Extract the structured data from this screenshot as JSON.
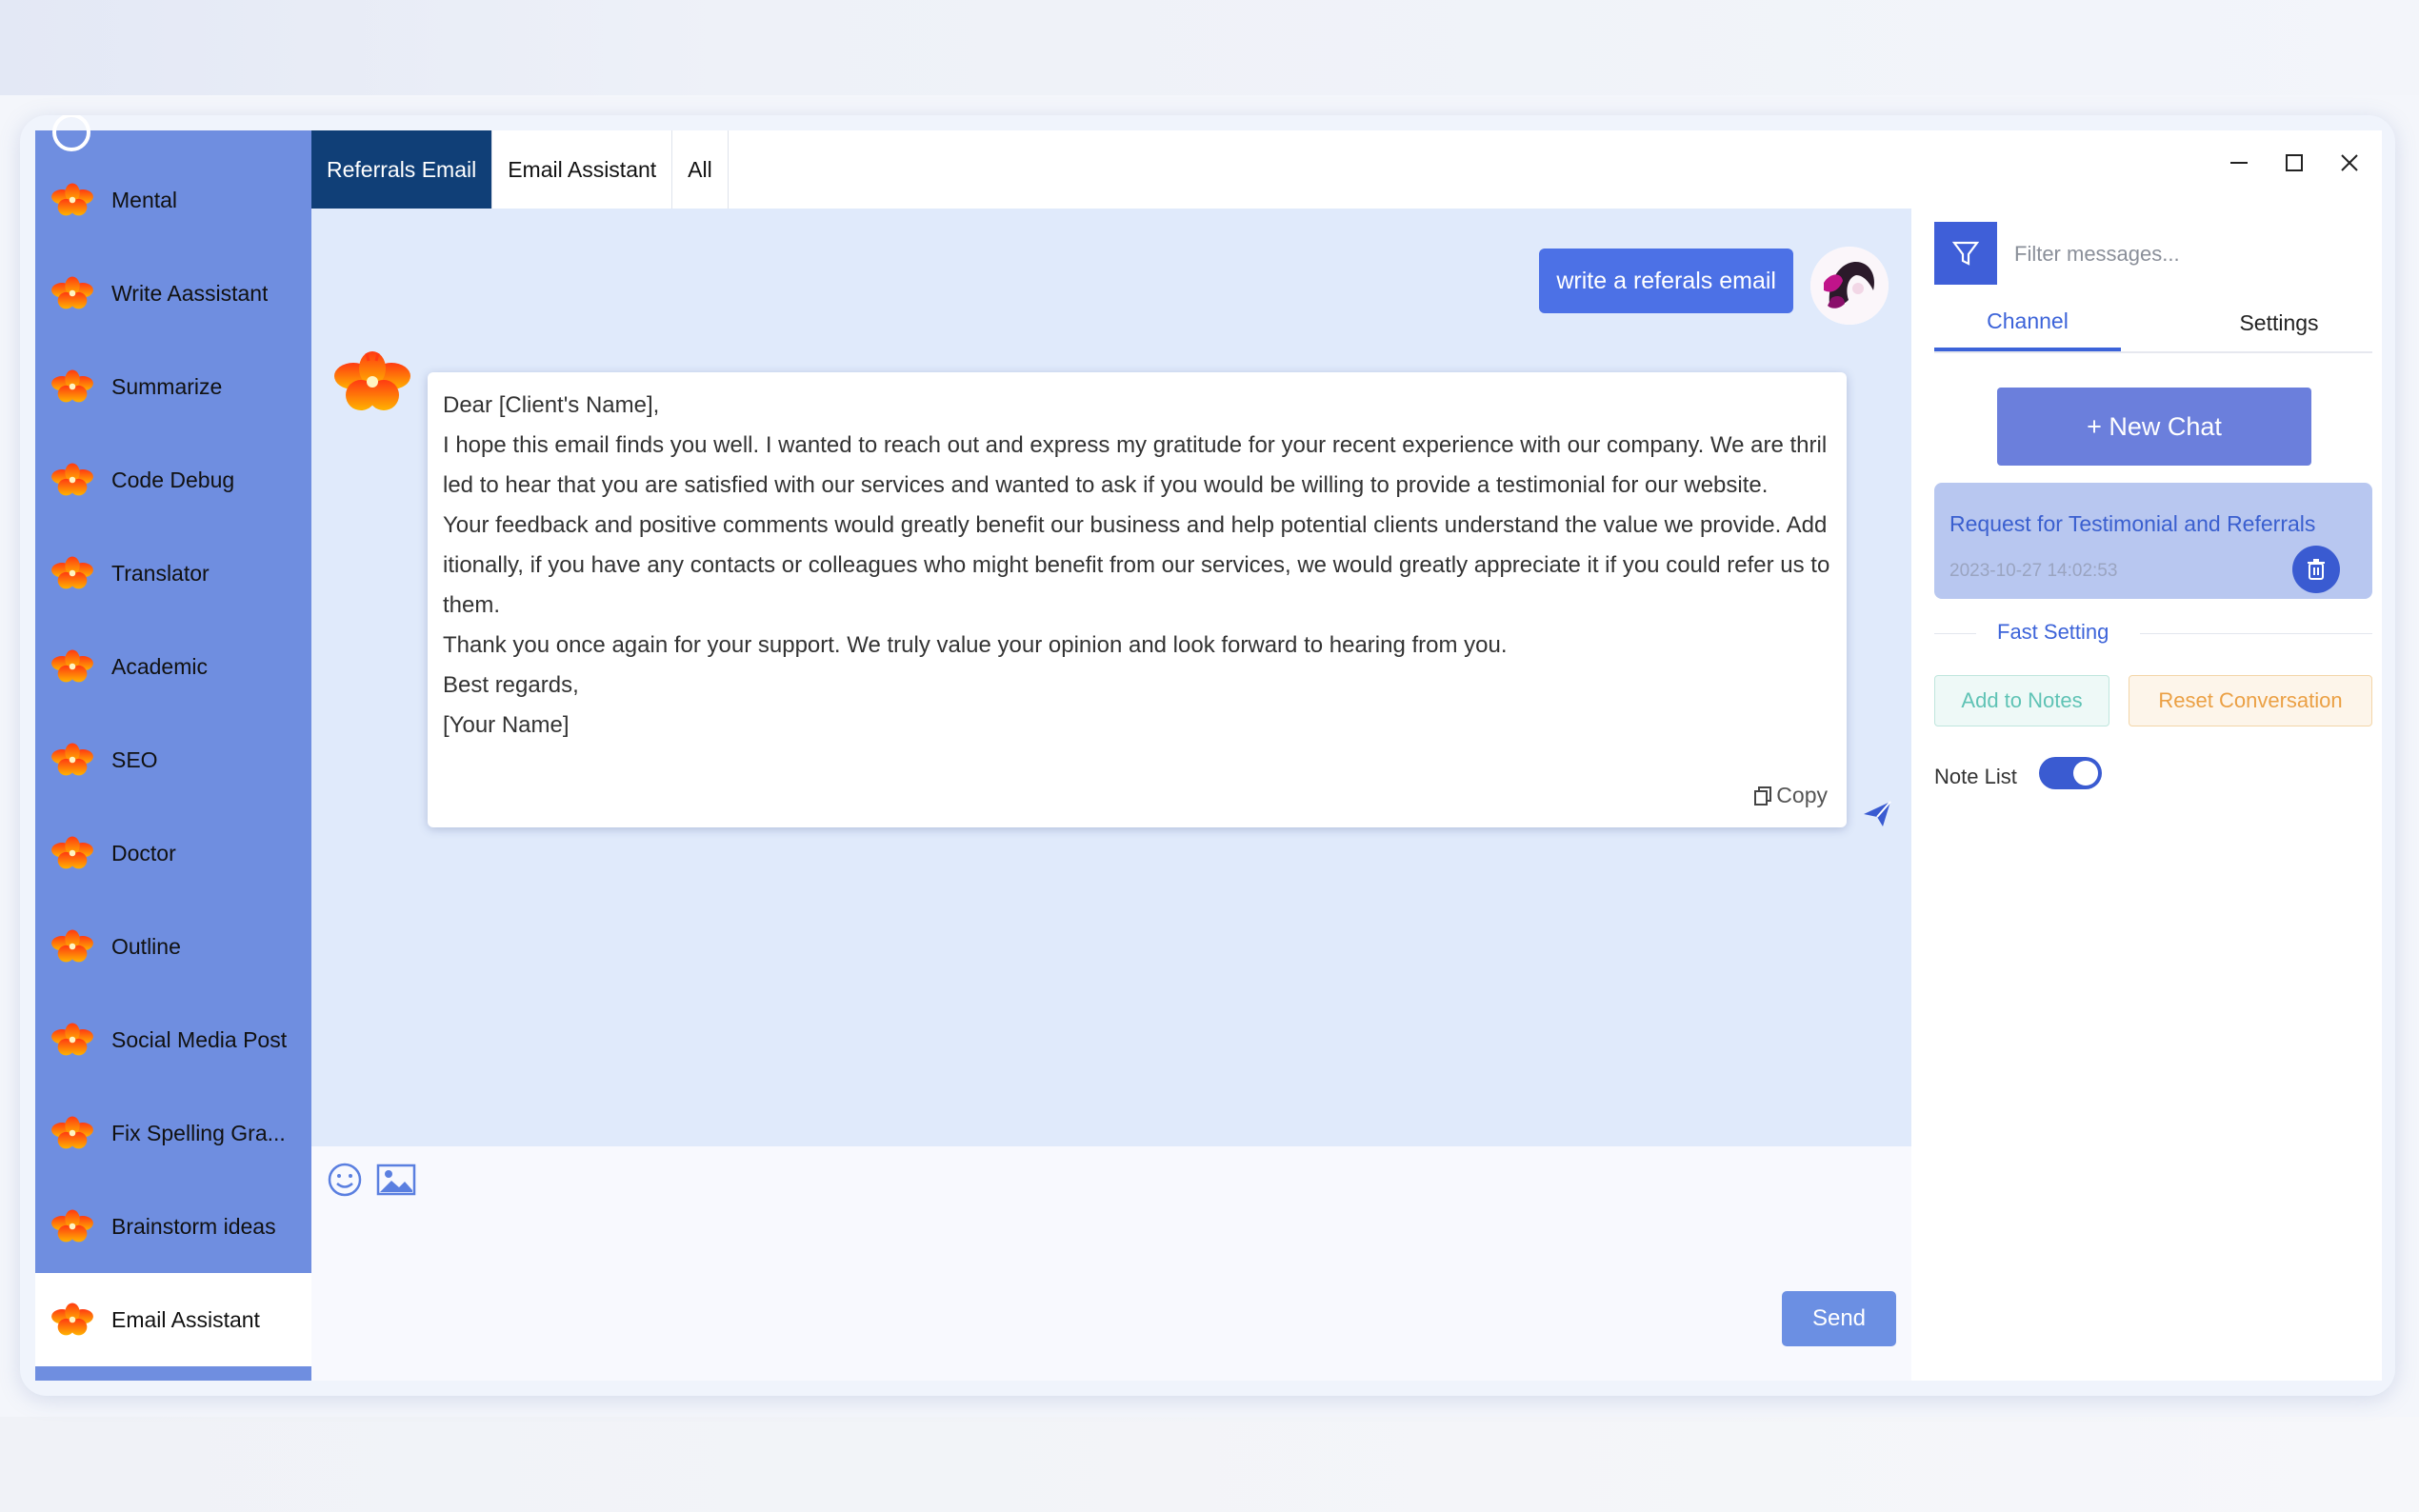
{
  "sidebar": {
    "items": [
      {
        "label": "Mental"
      },
      {
        "label": "Write Aassistant"
      },
      {
        "label": "Summarize"
      },
      {
        "label": "Code Debug"
      },
      {
        "label": "Translator"
      },
      {
        "label": "Academic"
      },
      {
        "label": "SEO"
      },
      {
        "label": "Doctor"
      },
      {
        "label": "Outline"
      },
      {
        "label": "Social Media Post"
      },
      {
        "label": "Fix Spelling Gra..."
      },
      {
        "label": "Brainstorm ideas"
      },
      {
        "label": "Email Assistant"
      }
    ],
    "active_index": 12,
    "item_icon": "flower-icon",
    "colors": {
      "background": "#6f8ee0",
      "active_background": "#ffffff"
    }
  },
  "tabs": [
    {
      "label": "Referrals Email",
      "active": true
    },
    {
      "label": "Email Assistant",
      "active": false
    },
    {
      "label": "All",
      "active": false
    }
  ],
  "window_controls": {
    "minimize": "minimize-icon",
    "maximize": "maximize-icon",
    "close": "close-icon"
  },
  "chat": {
    "user_message": "write a referals email",
    "reply_lines": [
      "Dear [Client's Name],",
      "I hope this email finds you well. I wanted to reach out and express my gratitude for your recent experience with our company. We are thrilled to hear that you are satisfied with our services and wanted to ask if you would be willing to provide a testimonial for our website.",
      "Your feedback and positive comments would greatly benefit our business and help potential clients understand the value we provide. Additionally, if you have any contacts or colleagues who might benefit from our services, we would greatly appreciate it if you could refer us to them.",
      "Thank you once again for your support. We truly value your opinion and look forward to hearing from you.",
      "Best regards,",
      "[Your Name]"
    ],
    "copy_label": "Copy"
  },
  "composer": {
    "send_label": "Send",
    "icons": [
      "emoji-icon",
      "image-icon"
    ]
  },
  "right_panel": {
    "filter_placeholder": "Filter messages...",
    "tabs": [
      {
        "label": "Channel",
        "active": true
      },
      {
        "label": "Settings",
        "active": false
      }
    ],
    "new_chat_label": "+ New Chat",
    "conversation": {
      "title": "Request for Testimonial and Referrals",
      "timestamp": "2023-10-27 14:02:53"
    },
    "fast_setting_label": "Fast Setting",
    "add_to_notes_label": "Add to Notes",
    "reset_conversation_label": "Reset Conversation",
    "note_list_label": "Note List",
    "note_list_enabled": true,
    "colors": {
      "accent": "#3c63d9",
      "new_chat": "#6b7fdc"
    }
  }
}
